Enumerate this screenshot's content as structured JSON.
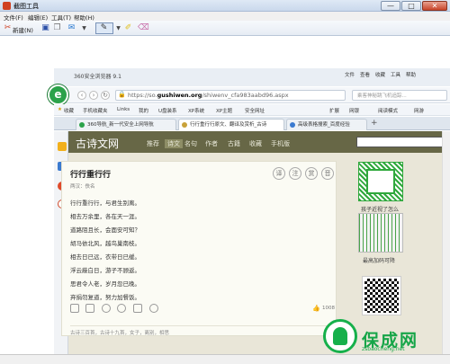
{
  "window": {
    "title": "截图工具",
    "controls": {
      "minimize": "—",
      "maximize": "□",
      "close": "✕"
    }
  },
  "menu": [
    "文件(F)",
    "编辑(E)",
    "工具(T)",
    "帮助(H)"
  ],
  "toolbar": {
    "new_label": "新建(N)"
  },
  "browser": {
    "title": "360安全浏览器 9.1",
    "menu": [
      "文件",
      "查看",
      "收藏",
      "工具",
      "帮助"
    ],
    "address": {
      "prefix": "https://so.",
      "domain": "gushiwen.org",
      "path": "/shiwenv_cfa983aabd96.aspx"
    },
    "search_placeholder": "乘客神秘跳飞机追踪...",
    "bookmarks": [
      "收藏",
      "手机收藏夹",
      "Links",
      "我的",
      "U盘装系",
      "XP系统",
      "XP主题",
      "安全网址",
      "扩展",
      "网银",
      "阅读模式",
      "网游"
    ],
    "tabs": [
      {
        "label": "360导航_新一代安全上网导航",
        "color": "#2ba24a"
      },
      {
        "label": "行行重行行原文、翻译及赏析_古诗",
        "color": "#c9a23a"
      },
      {
        "label": "高级表格搜索_百度经验",
        "color": "#3a7ad0"
      }
    ],
    "new_tab": "+"
  },
  "site": {
    "logo": "古诗文网",
    "nav": [
      "推荐",
      "诗文",
      "名句",
      "作者",
      "古籍",
      "收藏",
      "手机版"
    ],
    "active_nav": "诗文"
  },
  "poem": {
    "title": "行行重行行",
    "author": "两汉：佚名",
    "lines": [
      "行行重行行，与君生别离。",
      "相去万余里，各在天一涯。",
      "道路阻且长，会面安可知？",
      "胡马依北风，越鸟巢南枝。",
      "相去日已远，衣带日已缓。",
      "浮云蔽白日，游子不顾返。",
      "思君令人老，岁月忽已晚。",
      "弃捐勿复道，努力加餐饭。"
    ],
    "round_buttons": [
      "译",
      "注",
      "赏",
      "音"
    ],
    "likes": "1008",
    "tags": "古诗三百首，古诗十九首，女子，离别，相思"
  },
  "ads": {
    "caption1": "孩子近视了怎么",
    "caption2": "最高加码可降"
  },
  "watermark": {
    "name": "保成网",
    "url": "zsbaocheng.net"
  }
}
